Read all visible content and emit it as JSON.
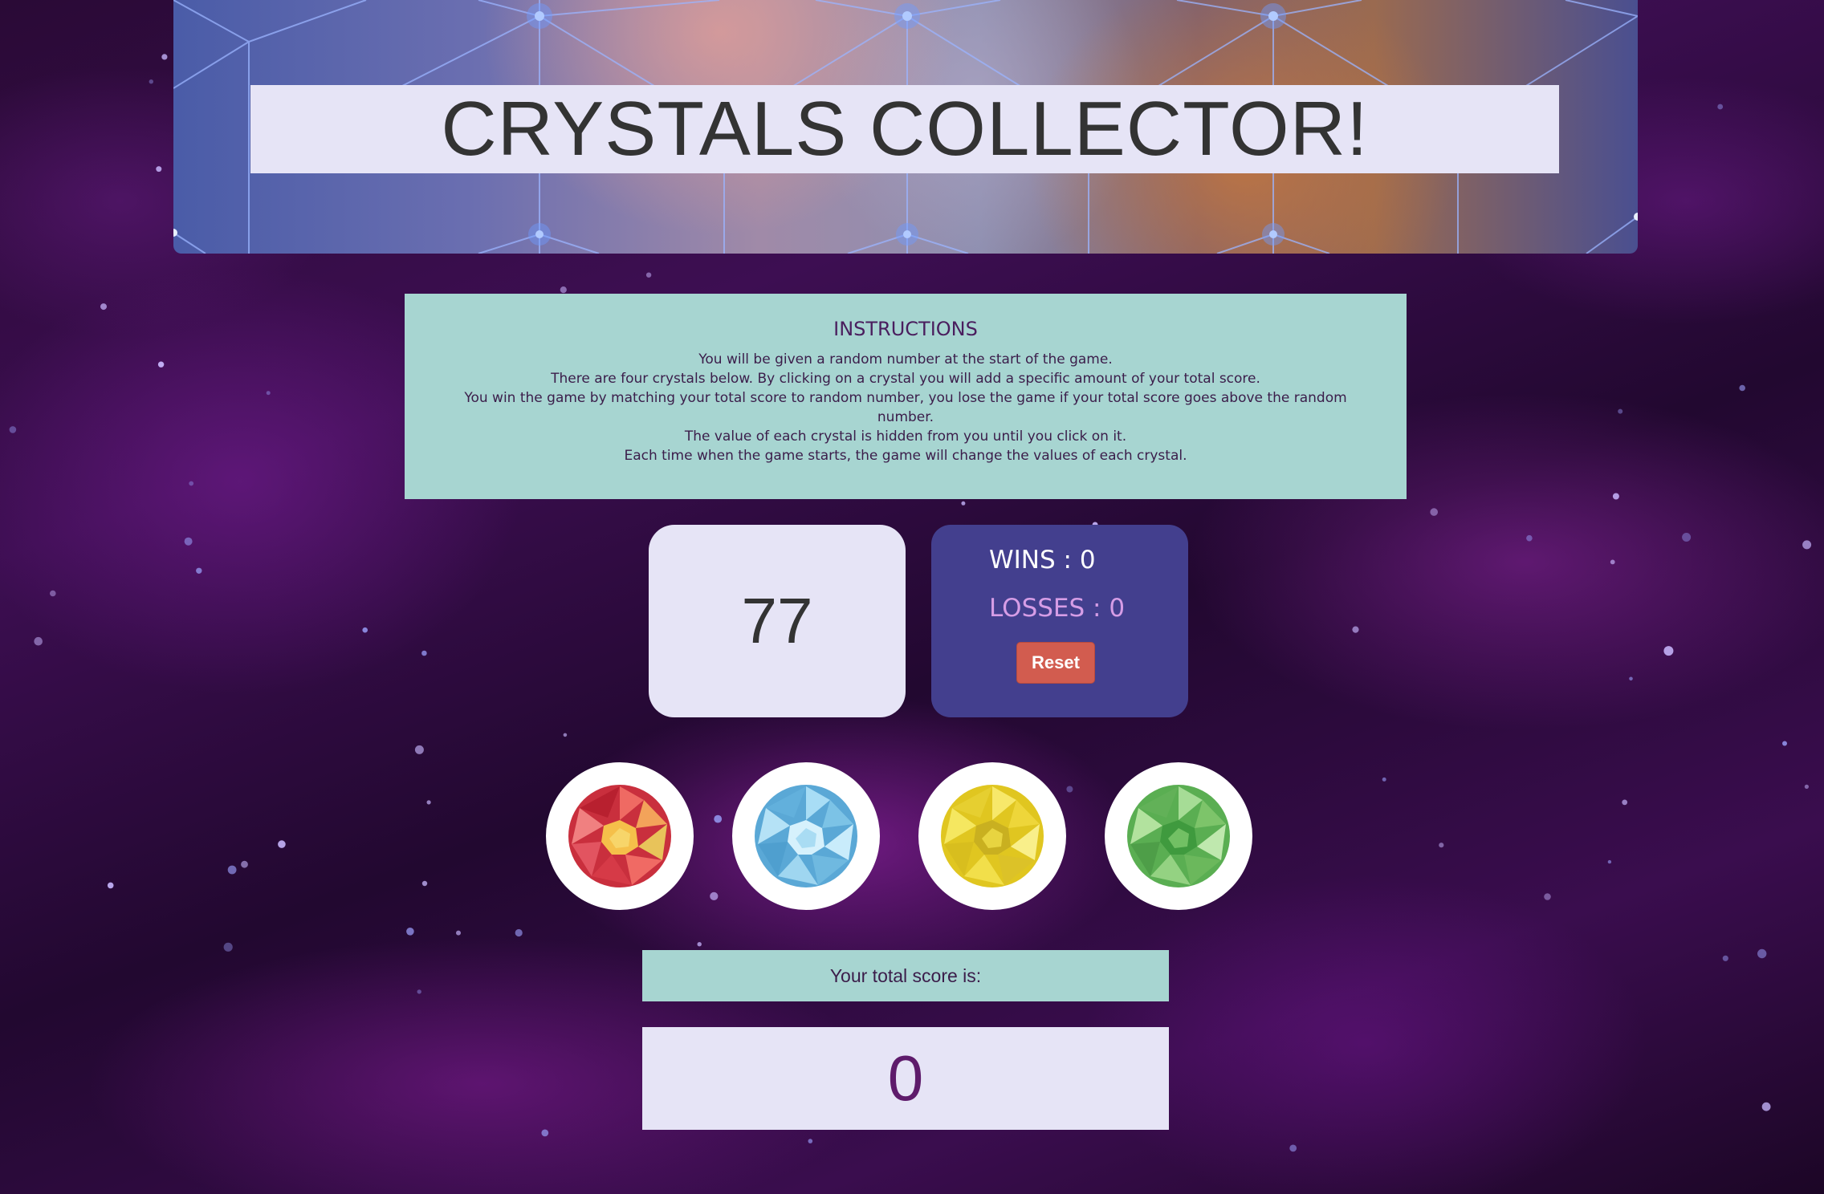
{
  "header": {
    "title": "CRYSTALS COLLECTOR!"
  },
  "instructions": {
    "heading": "INSTRUCTIONS",
    "lines": [
      "You will be given a random number at the start of the game.",
      "There are four crystals below. By clicking on a crystal you will add a specific amount of your total score.",
      "You win the game by matching your total score to random number, you lose the game if your total score goes above the random number.",
      "The value of each crystal is hidden from you until you click on it.",
      "Each time when the game starts, the game will change the values of each crystal."
    ]
  },
  "game": {
    "target_number": "77",
    "wins_text": "WINS : 0",
    "losses_text": "LOSSES : 0",
    "reset_label": "Reset"
  },
  "crystals": [
    {
      "icon": "red-crystal-icon",
      "color": "#e0474f"
    },
    {
      "icon": "blue-crystal-icon",
      "color": "#7cc3e6"
    },
    {
      "icon": "yellow-crystal-icon",
      "color": "#f0dc3a"
    },
    {
      "icon": "green-crystal-icon",
      "color": "#7dc46a"
    }
  ],
  "score": {
    "label": "Your total score is:",
    "value": "0"
  },
  "colors": {
    "panel_teal": "#a7d5d1",
    "panel_lavender": "#e6e4f6",
    "stats_indigo": "#433f8e",
    "reset_red": "#d25c4f",
    "losses_pink": "#d69de6"
  }
}
